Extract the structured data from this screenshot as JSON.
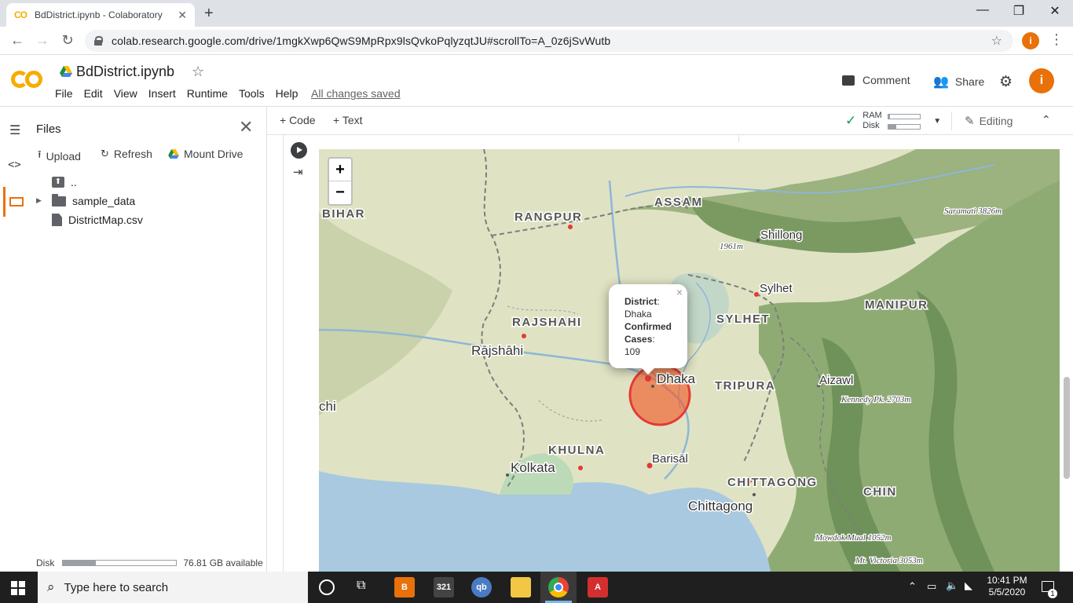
{
  "browser": {
    "tab_title": "BdDistrict.ipynb - Colaboratory",
    "tab_logo": "CO",
    "url": "colab.research.google.com/drive/1mgkXwp6QwS9MpRpx9lsQvkoPqlyzqtJU#scrollTo=A_0z6jSvWutb",
    "profile_initial": "i"
  },
  "colab": {
    "notebook_title": "BdDistrict.ipynb",
    "menus": [
      "File",
      "Edit",
      "View",
      "Insert",
      "Runtime",
      "Tools",
      "Help"
    ],
    "save_status": "All changes saved",
    "comment_label": "Comment",
    "share_label": "Share",
    "user_initial": "i",
    "toolbar": {
      "add_code": "+ Code",
      "add_text": "+ Text",
      "ram_label": "RAM",
      "disk_label": "Disk",
      "ram_usage_fraction": 0.05,
      "disk_usage_fraction": 0.25,
      "editing_label": "Editing"
    }
  },
  "files_panel": {
    "title": "Files",
    "upload_label": "Upload",
    "refresh_label": "Refresh",
    "mount_label": "Mount Drive",
    "entries": [
      {
        "name": "..",
        "type": "up"
      },
      {
        "name": "sample_data",
        "type": "folder"
      },
      {
        "name": "DistrictMap.csv",
        "type": "file"
      }
    ],
    "disk_label": "Disk",
    "disk_available": "76.81 GB available",
    "disk_usage_fraction": 0.29
  },
  "map": {
    "zoom_in": "+",
    "zoom_out": "−",
    "region_labels": [
      "BIHAR",
      "RANGPUR",
      "ASSAM",
      "RAJSHAHI",
      "SYLHET",
      "MANIPUR",
      "TRIPURA",
      "KHULNA",
      "CHITTAGONG",
      "CHIN"
    ],
    "city_labels": [
      "Shillong",
      "Sylhet",
      "Rājshāhi",
      "Dhaka",
      "Aizawl",
      "Kolkata",
      "Barisāl",
      "Chittagong",
      "chi"
    ],
    "peak_labels": [
      "Saramati 3826m",
      "1961m",
      "Kennedy Pk. 2703m",
      "Mowdok Mual 1052m",
      "Mt. Victoria 3053m"
    ],
    "popup": {
      "district_label": "District",
      "district_value": "Dhaka",
      "cases_label": "Confirmed Cases",
      "cases_value": "109"
    },
    "colors": {
      "marker": "#e53935",
      "circle_fill": "#f4511e",
      "water": "#a9c9e0"
    }
  },
  "taskbar": {
    "search_placeholder": "Type here to search",
    "time": "10:41 PM",
    "date": "5/5/2020",
    "notification_count": "1"
  }
}
